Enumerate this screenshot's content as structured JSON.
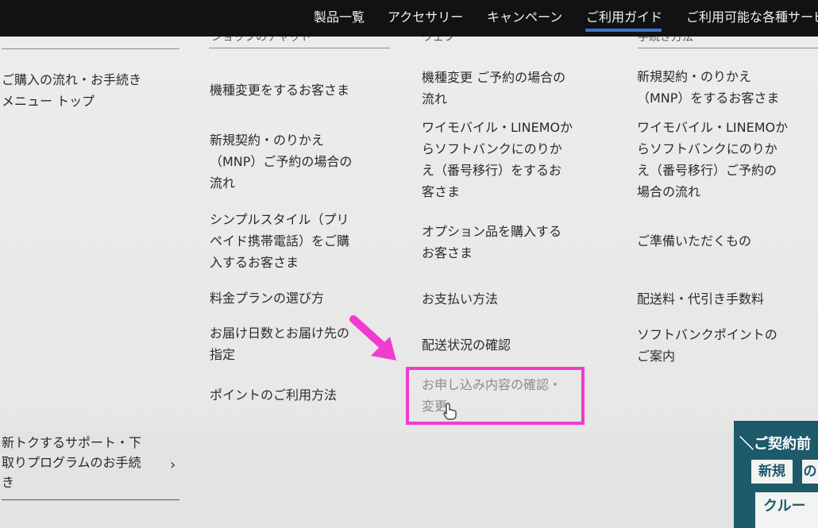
{
  "topnav": {
    "items": [
      "製品一覧",
      "アクセサリー",
      "キャンペーン",
      "ご利用ガイド",
      "ご利用可能な各種サービス"
    ],
    "active_index": 3,
    "accent_color": "#3a73c9"
  },
  "columns": {
    "col1": {
      "header": "",
      "items": [
        "ご購入の流れ・お手続き\nメニュー トップ"
      ]
    },
    "col2": {
      "header": "ショップのチャット",
      "items": [
        "機種変更をするお客さま",
        "新規契約・のりかえ\n（MNP）ご予約の場合の\n流れ",
        "シンプルスタイル（プリ\nペイド携帯電話）をご購\n入するお客さま",
        "料金プランの選び方",
        "お届け日数とお届け先の\n指定",
        "ポイントのご利用方法"
      ]
    },
    "col3": {
      "header": "ウェブ",
      "items": [
        "機種変更 ご予約の場合の\n流れ",
        "ワイモバイル・LINEMOか\nらソフトバンクにのりか\nえ（番号移行）をするお\n客さま",
        "オプション品を購入する\nお客さま",
        "お支払い方法",
        "配送状況の確認",
        "お申し込み内容の確認・\n変更"
      ]
    },
    "col4": {
      "header": "手続き方法",
      "items": [
        "新規契約・のりかえ\n（MNP）をするお客さま",
        "ワイモバイル・LINEMOか\nらソフトバンクにのりか\nえ（番号移行）ご予約の\n場合の流れ",
        "ご準備いただくもの",
        "配送料・代引き手数料",
        "ソフトバンクポイントの\nご案内"
      ]
    }
  },
  "bottom_link": "新トクするサポート・下\n取りプログラムのお手続\nき",
  "chevron_glyph": "›",
  "banner": {
    "title": "＼ご契約前",
    "pill1": "新規",
    "pill1b": "の",
    "pill2": "クルー",
    "bg_color": "#1d5a6a"
  },
  "highlight_color": "#f23bd0",
  "cursor_icon": "hand-pointer-icon",
  "arrow_icon": "pink-arrow-icon"
}
